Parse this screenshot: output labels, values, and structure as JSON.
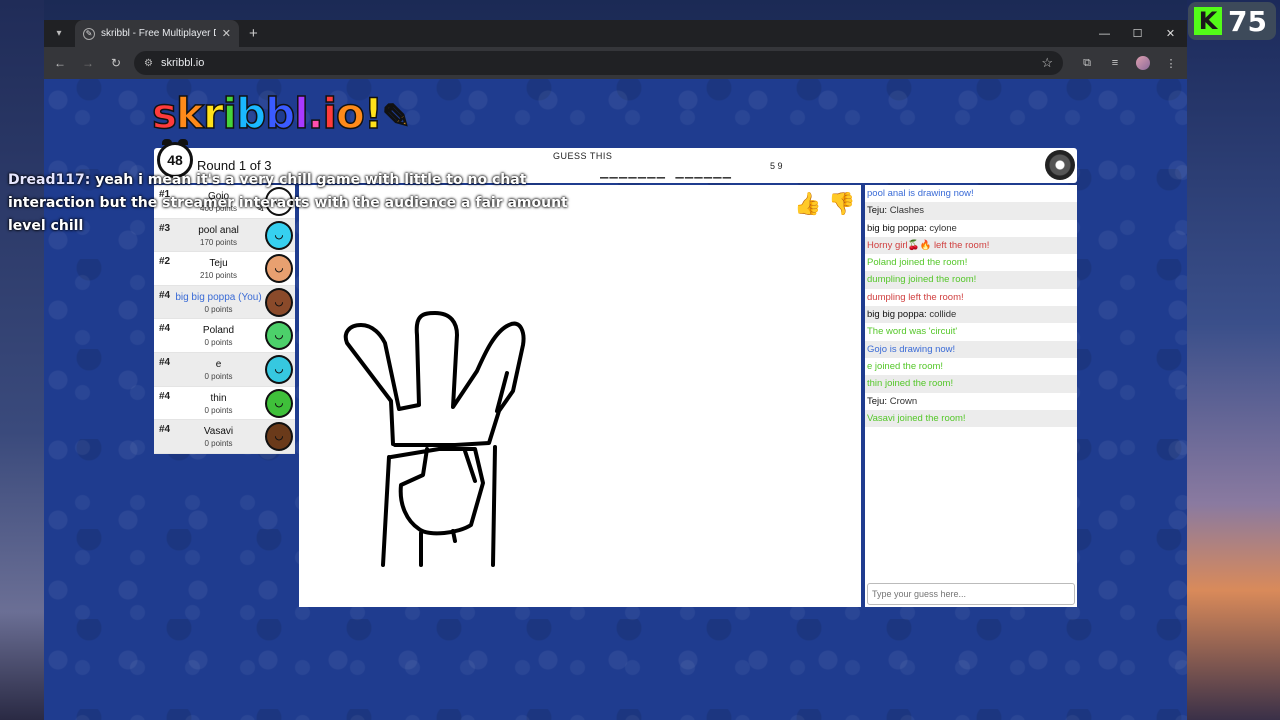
{
  "stream": {
    "viewer_count": "75"
  },
  "overlay_chat": {
    "user": "Dread117:",
    "lines": [
      "yeah i mean it's a very chill game with little to no chat",
      "interaction but the streamer interacts with the audience a fair amount",
      "level chill"
    ]
  },
  "browser": {
    "tab_title": "skribbl - Free Multiplayer Drawing",
    "url": "skribbl.io"
  },
  "game": {
    "logo": "skribbl.io",
    "timer": "48",
    "round": "Round 1 of 3",
    "guess_label": "GUESS THIS",
    "hint": "_______ ______",
    "word_lengths": "5 9"
  },
  "players": [
    {
      "rank": "#1",
      "name": "Gojo",
      "points": "400 points",
      "avatar_color": "#ffffff",
      "drawing": true
    },
    {
      "rank": "#3",
      "name": "pool anal",
      "points": "170 points",
      "avatar_color": "#36d0f0"
    },
    {
      "rank": "#2",
      "name": "Teju",
      "points": "210 points",
      "avatar_color": "#e8a070"
    },
    {
      "rank": "#4",
      "name": "big big poppa (You)",
      "points": "0 points",
      "avatar_color": "#8a4a2a",
      "you": true
    },
    {
      "rank": "#4",
      "name": "Poland",
      "points": "0 points",
      "avatar_color": "#4cd06a"
    },
    {
      "rank": "#4",
      "name": "e",
      "points": "0 points",
      "avatar_color": "#36c8e0"
    },
    {
      "rank": "#4",
      "name": "thin",
      "points": "0 points",
      "avatar_color": "#3fc03a"
    },
    {
      "rank": "#4",
      "name": "Vasavi",
      "points": "0 points",
      "avatar_color": "#6a3a1a"
    }
  ],
  "chat": [
    {
      "type": "draw",
      "text": "pool anal is drawing now!"
    },
    {
      "type": "guess",
      "user": "Teju:",
      "text": "Clashes"
    },
    {
      "type": "guess",
      "user": "big big poppa:",
      "text": "cylone"
    },
    {
      "type": "leave",
      "text": "Horny girl🍒🔥 left the room!"
    },
    {
      "type": "join",
      "text": "Poland joined the room!"
    },
    {
      "type": "join",
      "text": "dumpling joined the room!"
    },
    {
      "type": "leave",
      "text": "dumpling left the room!"
    },
    {
      "type": "guess",
      "user": "big big poppa:",
      "text": "collide"
    },
    {
      "type": "join",
      "text": "The word was 'circuit'"
    },
    {
      "type": "draw",
      "text": "Gojo is drawing now!"
    },
    {
      "type": "join",
      "text": "e joined the room!"
    },
    {
      "type": "join",
      "text": "thin joined the room!"
    },
    {
      "type": "guess",
      "user": "Teju:",
      "text": "Crown"
    },
    {
      "type": "join",
      "text": "Vasavi joined the room!"
    }
  ],
  "chat_input": {
    "placeholder": "Type your guess here..."
  }
}
